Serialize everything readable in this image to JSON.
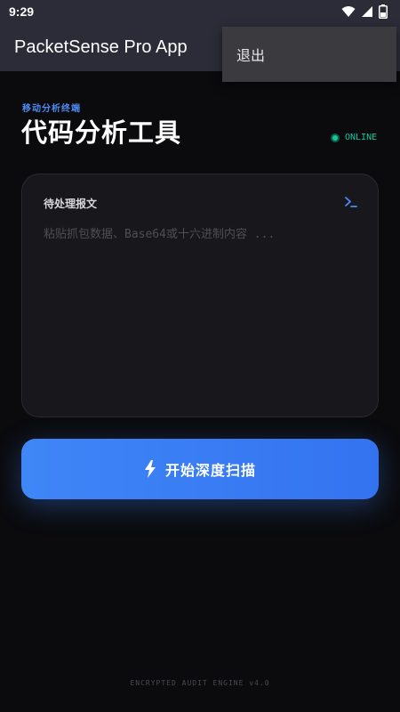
{
  "status_bar": {
    "time": "9:29"
  },
  "app_bar": {
    "title": "PacketSense Pro App"
  },
  "overflow_menu": {
    "items": [
      {
        "label": "退出"
      }
    ]
  },
  "header": {
    "eyebrow": "移动分析终端",
    "title": "代码分析工具",
    "status": "ONLINE",
    "status_color": "#16c79a"
  },
  "input_card": {
    "label": "待处理报文",
    "placeholder": "粘贴抓包数据、Base64或十六进制内容 ...",
    "value": "",
    "icon": "terminal-icon"
  },
  "scan_button": {
    "label": "开始深度扫描",
    "icon": "lightning-icon",
    "color": "#3b7ff5"
  },
  "footer": {
    "text": "ENCRYPTED AUDIT ENGINE v4.0"
  }
}
